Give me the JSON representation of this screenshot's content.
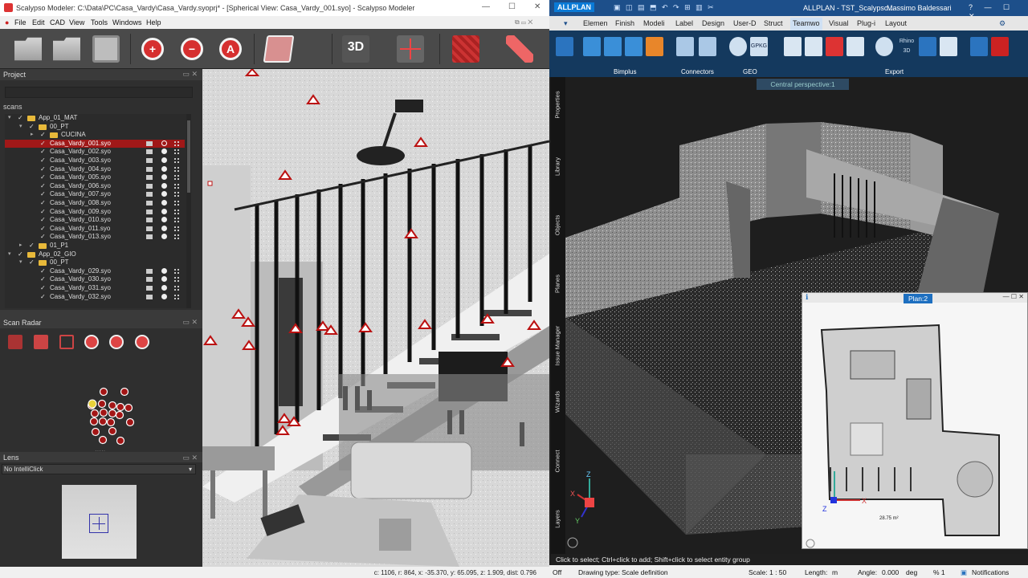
{
  "left_app": {
    "title": "Scalypso Modeler: C:\\Data\\PC\\Casa_Vardy\\Casa_Vardy.syoprj* - [Spherical View: Casa_Vardy_001.syo] - Scalypso Modeler",
    "menu": [
      "File",
      "Edit",
      "CAD",
      "View",
      "Tools",
      "Windows",
      "Help"
    ],
    "toolbar_3d_label": "3D",
    "project_panel": {
      "title": "Project",
      "scans_label": "scans",
      "tree": [
        {
          "label": "App_01_MAT",
          "type": "folder",
          "indent": 0,
          "expander": "▾"
        },
        {
          "label": "00_PT",
          "type": "folder",
          "indent": 1,
          "expander": "▾"
        },
        {
          "label": "CUCINA",
          "type": "folder",
          "indent": 2,
          "expander": "▸"
        },
        {
          "label": "Casa_Vardy_001.syo",
          "type": "scan",
          "indent": 2,
          "selected": true
        },
        {
          "label": "Casa_Vardy_002.syo",
          "type": "scan",
          "indent": 2
        },
        {
          "label": "Casa_Vardy_003.syo",
          "type": "scan",
          "indent": 2
        },
        {
          "label": "Casa_Vardy_004.syo",
          "type": "scan",
          "indent": 2
        },
        {
          "label": "Casa_Vardy_005.syo",
          "type": "scan",
          "indent": 2
        },
        {
          "label": "Casa_Vardy_006.syo",
          "type": "scan",
          "indent": 2
        },
        {
          "label": "Casa_Vardy_007.syo",
          "type": "scan",
          "indent": 2
        },
        {
          "label": "Casa_Vardy_008.syo",
          "type": "scan",
          "indent": 2
        },
        {
          "label": "Casa_Vardy_009.syo",
          "type": "scan",
          "indent": 2
        },
        {
          "label": "Casa_Vardy_010.syo",
          "type": "scan",
          "indent": 2
        },
        {
          "label": "Casa_Vardy_011.syo",
          "type": "scan",
          "indent": 2
        },
        {
          "label": "Casa_Vardy_013.syo",
          "type": "scan",
          "indent": 2
        },
        {
          "label": "01_P1",
          "type": "folder",
          "indent": 1,
          "expander": "▸"
        },
        {
          "label": "App_02_GIO",
          "type": "folder",
          "indent": 0,
          "expander": "▾"
        },
        {
          "label": "00_PT",
          "type": "folder",
          "indent": 1,
          "expander": "▾"
        },
        {
          "label": "Casa_Vardy_029.syo",
          "type": "scan",
          "indent": 2
        },
        {
          "label": "Casa_Vardy_030.syo",
          "type": "scan",
          "indent": 2
        },
        {
          "label": "Casa_Vardy_031.syo",
          "type": "scan",
          "indent": 2
        },
        {
          "label": "Casa_Vardy_032.syo",
          "type": "scan",
          "indent": 2
        }
      ]
    },
    "scan_radar_panel": {
      "title": "Scan Radar"
    },
    "lens_panel": {
      "title": "Lens",
      "mode": "No IntelliClick"
    },
    "status": "c: 1106, r: 864,   x: -35.370, y: 65.095, z: 1.909, dist: 0.796"
  },
  "right_app": {
    "title": "ALLPLAN - TST_Scalypso...",
    "brand": "ALLPLAN",
    "user": "Massimo Baldessari",
    "tabs": [
      "Elemen",
      "Finish",
      "Modeli",
      "Label",
      "Design",
      "User-D",
      "Struct",
      "Teamwo",
      "Visual",
      "Plug-i",
      "Layout"
    ],
    "active_tab": "Teamwo",
    "ribbon_groups": [
      "Bimplus",
      "Connectors",
      "GEO",
      "Export"
    ],
    "ribbon_texts": {
      "rhino": "Rhino 3D",
      "gpkg": "GPKG"
    },
    "side_tabs": [
      "Properties",
      "Library",
      "Objects",
      "Planes",
      "Issue Manager",
      "Wizards",
      "Connect",
      "Layers"
    ],
    "perspective_label": "Central perspective:1",
    "plan_label": "Plan:2",
    "plan_area": "28.75 m²",
    "axes": {
      "x": "X",
      "y": "Y",
      "z": "Z"
    },
    "command_line": "Click to select; Ctrl+click to add; Shift+click to select entity group",
    "status": {
      "mode": "Off",
      "drawing_type": "Drawing type:",
      "drawing_value": "Scale definition",
      "scale_label": "Scale:",
      "scale": "1 : 50",
      "length_label": "Length:",
      "length_unit": "m",
      "angle_label": "Angle:",
      "angle": "0.000",
      "angle_unit": "deg",
      "percent": "% 1",
      "notifications": "Notifications"
    },
    "accent_color": "#1d4f8a"
  }
}
